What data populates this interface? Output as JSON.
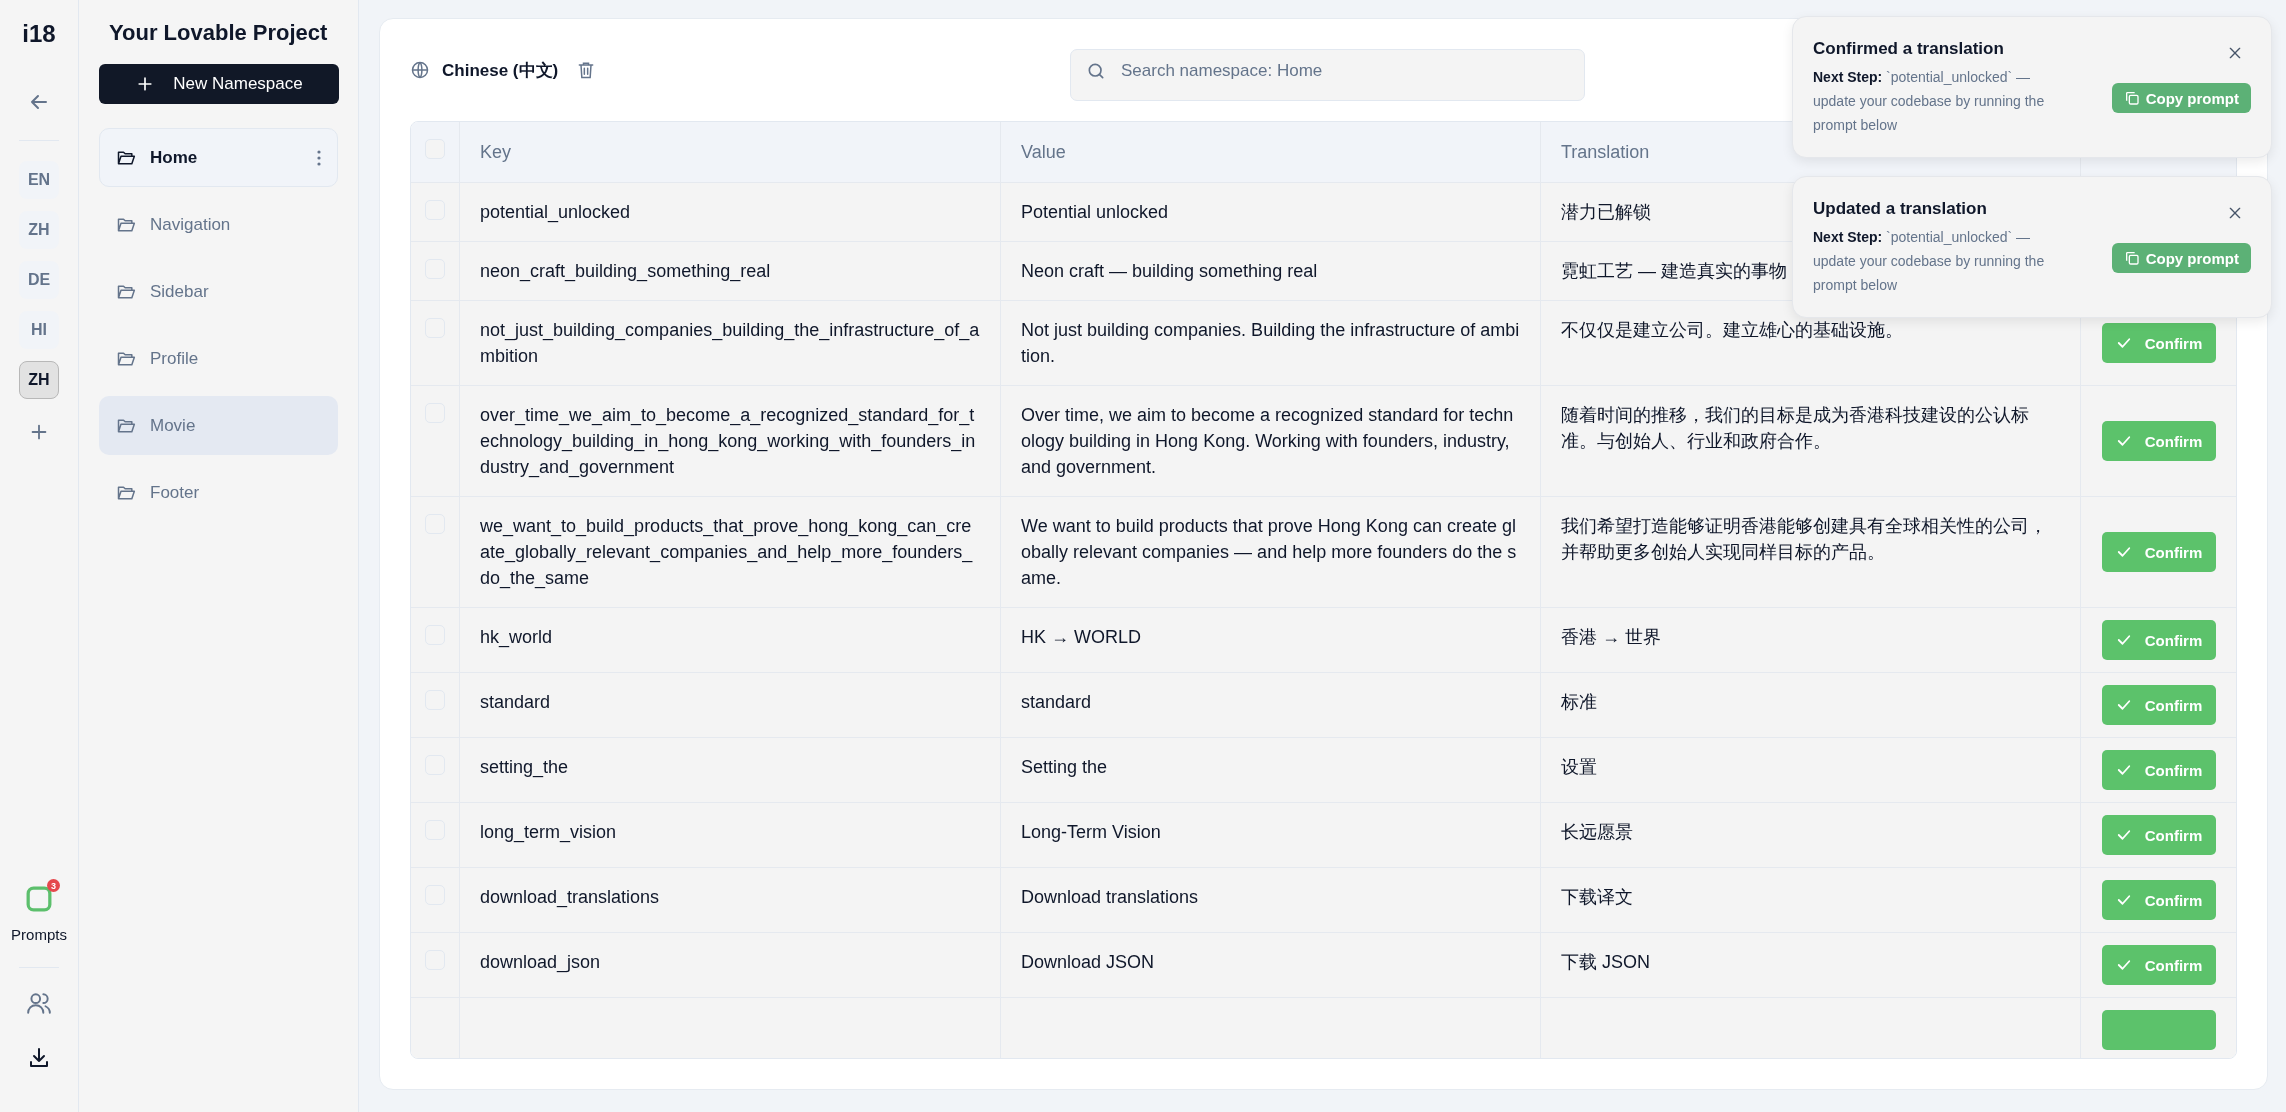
{
  "rail": {
    "logo": "i18",
    "languages": [
      {
        "code": "EN",
        "selected": false
      },
      {
        "code": "ZH",
        "selected": false
      },
      {
        "code": "DE",
        "selected": false
      },
      {
        "code": "HI",
        "selected": false
      },
      {
        "code": "ZH",
        "selected": true
      }
    ],
    "prompts": {
      "label": "Prompts",
      "badge": "3"
    }
  },
  "sidebar": {
    "title": "Your Lovable Project",
    "new_button": "New Namespace",
    "items": [
      {
        "label": "Home",
        "selected": true,
        "hovered": false
      },
      {
        "label": "Navigation",
        "selected": false,
        "hovered": false
      },
      {
        "label": "Sidebar",
        "selected": false,
        "hovered": false
      },
      {
        "label": "Profile",
        "selected": false,
        "hovered": false
      },
      {
        "label": "Movie",
        "selected": false,
        "hovered": true
      },
      {
        "label": "Footer",
        "selected": false,
        "hovered": false
      }
    ]
  },
  "toolbar": {
    "language": "Chinese (中文)",
    "search": {
      "placeholder": "Search namespace: Home"
    }
  },
  "table": {
    "columns": [
      "Key",
      "Value",
      "Translation"
    ],
    "header_checked": false,
    "more_rows_below": true,
    "rows": [
      {
        "key": "potential_unlocked",
        "value": "Potential unlocked",
        "translation": "潜力已解锁",
        "checked": false
      },
      {
        "key": "neon_craft_building_something_real",
        "value": "Neon craft — building something real",
        "translation": "霓虹工艺 — 建造真实的事物",
        "checked": false
      },
      {
        "key": "not_just_building_companies_building_the_infrastructure_of_ambition",
        "value": "Not just building companies. Building the infrastructure of ambition.",
        "translation": "不仅仅是建立公司。建立雄心的基础设施。",
        "checked": false,
        "action": "Confirm"
      },
      {
        "key": "over_time_we_aim_to_become_a_recognized_standard_for_technology_building_in_hong_kong_working_with_founders_industry_and_government",
        "value": "Over time, we aim to become a recognized standard for technology building in Hong Kong. Working with founders, industry, and government.",
        "translation": "随着时间的推移，我们的目标是成为香港科技建设的公认标准。与创始人、行业和政府合作。",
        "checked": false,
        "action": "Confirm"
      },
      {
        "key": "we_want_to_build_products_that_prove_hong_kong_can_create_globally_relevant_companies_and_help_more_founders_do_the_same",
        "value": "We want to build products that prove Hong Kong can create globally relevant companies — and help more founders do the same.",
        "translation": "我们希望打造能够证明香港能够创建具有全球相关性的公司，并帮助更多创始人实现同样目标的产品。",
        "checked": false,
        "action": "Confirm"
      },
      {
        "key": "hk_world",
        "value": "HK → WORLD",
        "translation": "香港 → 世界",
        "checked": false,
        "action": "Confirm"
      },
      {
        "key": "standard",
        "value": "standard",
        "translation": "标准",
        "checked": false,
        "action": "Confirm"
      },
      {
        "key": "setting_the",
        "value": "Setting the",
        "translation": "设置",
        "checked": false,
        "action": "Confirm"
      },
      {
        "key": "long_term_vision",
        "value": "Long-Term Vision",
        "translation": "长远愿景",
        "checked": false,
        "action": "Confirm"
      },
      {
        "key": "download_translations",
        "value": "Download translations",
        "translation": "下载译文",
        "checked": false,
        "action": "Confirm"
      },
      {
        "key": "download_json",
        "value": "Download JSON",
        "translation": "下载 JSON",
        "checked": false,
        "action": "Confirm"
      }
    ]
  },
  "toasts": [
    {
      "title": "Confirmed a translation",
      "message": "**Next Step:** `potential_unlocked` — update your codebase by running the prompt below",
      "button": "Copy prompt"
    },
    {
      "title": "Updated a translation",
      "message": "**Next Step:** `potential_unlocked` — update your codebase by running the prompt below",
      "button": "Copy prompt"
    }
  ]
}
